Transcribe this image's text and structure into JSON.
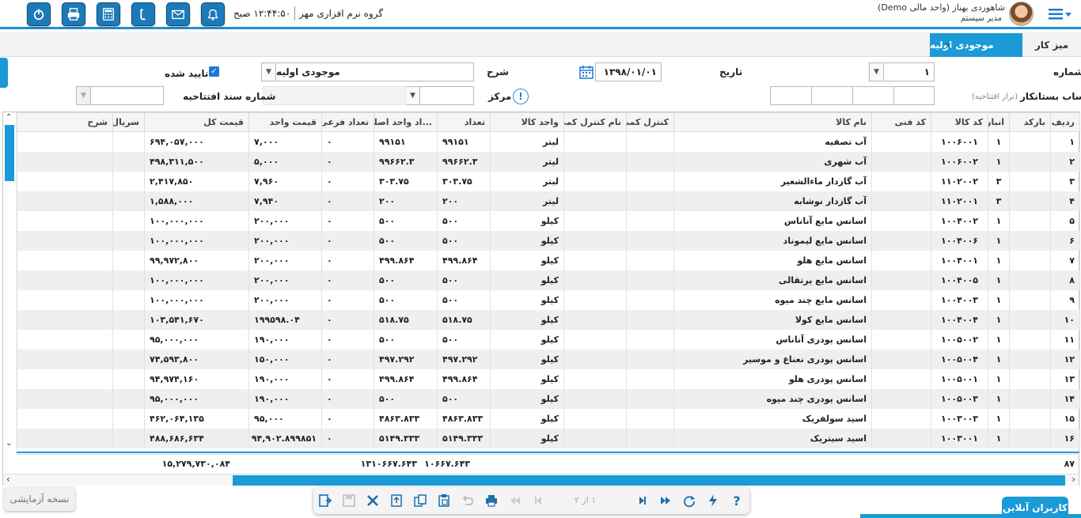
{
  "header": {
    "company": "گروه نرم افزاری مهر",
    "clock": "۱۲:۴۴:۵۰ صبح",
    "user_name": "شاهوردی بهناز (واحد مالی Demo)",
    "user_role": "مدیر سیستم",
    "buttons": [
      "power-icon",
      "printer-icon",
      "calculator-icon",
      "phone-icon",
      "mail-icon",
      "bell-icon"
    ]
  },
  "tabs": {
    "desk": "میز کار",
    "active": "موجودی اولیه",
    "close": "×"
  },
  "form": {
    "number_label": "شماره",
    "number_value": "۱",
    "date_label": "تاریخ",
    "date_value": "۱۳۹۸/۰۱/۰۱",
    "desc_label": "شرح",
    "desc_value": "موجودی اولیه",
    "approved_label": "تایید شده",
    "creditor_label": "حساب بستانکار",
    "creditor_sub": "(تراز افتتاحیه)",
    "center_label": "مرکز",
    "opening_doc_label": "شماره سند افتتاحیه"
  },
  "grid": {
    "columns": [
      "ردیف",
      "بارکد",
      "انبار",
      "کد کالا",
      "کد فنی",
      "نام کالا",
      "کنترل کمی",
      "نام کنترل کمی",
      "واحد کالا",
      "تعداد",
      "...اد واحد اصلی",
      "تعداد فرعی",
      "قیمت واحد",
      "قیمت کل",
      "سریال",
      "شرح"
    ],
    "rows": [
      {
        "n": "۱",
        "store": "۱",
        "code": "۱۰۰۶۰۰۱",
        "name": "آب تصفیه",
        "unit": "لیتر",
        "qty": "۹۹۱۵۱",
        "base": "۹۹۱۵۱",
        "sub": "۰",
        "price": "۷,۰۰۰",
        "total": "۶۹۴,۰۵۷,۰۰۰"
      },
      {
        "n": "۲",
        "store": "۱",
        "code": "۱۰۰۶۰۰۲",
        "name": "آب شهری",
        "unit": "لیتر",
        "qty": "۹۹۶۶۲.۳",
        "base": "۹۹۶۶۲.۳",
        "sub": "۰",
        "price": "۵,۰۰۰",
        "total": "۴۹۸,۳۱۱,۵۰۰"
      },
      {
        "n": "۳",
        "store": "۳",
        "code": "۱۱۰۲۰۰۲",
        "name": "آب گازدار ماءالشعیر",
        "unit": "لیتر",
        "qty": "۳۰۳.۷۵",
        "base": "۳۰۳.۷۵",
        "sub": "۰",
        "price": "۷,۹۶۰",
        "total": "۲,۴۱۷,۸۵۰"
      },
      {
        "n": "۴",
        "store": "۳",
        "code": "۱۱۰۲۰۰۱",
        "name": "آب گازدار نوشابه",
        "unit": "لیتر",
        "qty": "۲۰۰",
        "base": "۲۰۰",
        "sub": "۰",
        "price": "۷,۹۴۰",
        "total": "۱,۵۸۸,۰۰۰"
      },
      {
        "n": "۵",
        "store": "۱",
        "code": "۱۰۰۴۰۰۲",
        "name": "اسانس مایع آناناس",
        "unit": "کیلو",
        "qty": "۵۰۰",
        "base": "۵۰۰",
        "sub": "۰",
        "price": "۲۰۰,۰۰۰",
        "total": "۱۰۰,۰۰۰,۰۰۰"
      },
      {
        "n": "۶",
        "store": "۱",
        "code": "۱۰۰۴۰۰۶",
        "name": "اسانس مایع لیموناد",
        "unit": "کیلو",
        "qty": "۵۰۰",
        "base": "۵۰۰",
        "sub": "۰",
        "price": "۲۰۰,۰۰۰",
        "total": "۱۰۰,۰۰۰,۰۰۰"
      },
      {
        "n": "۷",
        "store": "۱",
        "code": "۱۰۰۴۰۰۱",
        "name": "اسانس مایع هلو",
        "unit": "کیلو",
        "qty": "۴۹۹.۸۶۴",
        "base": "۴۹۹.۸۶۴",
        "sub": "۰",
        "price": "۲۰۰,۰۰۰",
        "total": "۹۹,۹۷۲,۸۰۰"
      },
      {
        "n": "۸",
        "store": "۱",
        "code": "۱۰۰۴۰۰۵",
        "name": "اسانس مایع پرتقالی",
        "unit": "کیلو",
        "qty": "۵۰۰",
        "base": "۵۰۰",
        "sub": "۰",
        "price": "۲۰۰,۰۰۰",
        "total": "۱۰۰,۰۰۰,۰۰۰"
      },
      {
        "n": "۹",
        "store": "۱",
        "code": "۱۰۰۴۰۰۳",
        "name": "اسانس مایع چند میوه",
        "unit": "کیلو",
        "qty": "۵۰۰",
        "base": "۵۰۰",
        "sub": "۰",
        "price": "۲۰۰,۰۰۰",
        "total": "۱۰۰,۰۰۰,۰۰۰"
      },
      {
        "n": "۱۰",
        "store": "۱",
        "code": "۱۰۰۴۰۰۴",
        "name": "اسانس مایع کولا",
        "unit": "کیلو",
        "qty": "۵۱۸.۷۵",
        "base": "۵۱۸.۷۵",
        "sub": "۰",
        "price": "۱۹۹۵۹۸.۰۴",
        "total": "۱۰۳,۵۴۱,۶۷۰"
      },
      {
        "n": "۱۱",
        "store": "۱",
        "code": "۱۰۰۵۰۰۲",
        "name": "اسانس پودری آناناس",
        "unit": "کیلو",
        "qty": "۵۰۰",
        "base": "۵۰۰",
        "sub": "۰",
        "price": "۱۹۰,۰۰۰",
        "total": "۹۵,۰۰۰,۰۰۰"
      },
      {
        "n": "۱۲",
        "store": "۱",
        "code": "۱۰۰۵۰۰۴",
        "name": "اسانس پودری نعناع و موسیر",
        "unit": "کیلو",
        "qty": "۴۹۷.۲۹۲",
        "base": "۴۹۷.۲۹۲",
        "sub": "۰",
        "price": "۱۵۰,۰۰۰",
        "total": "۷۴,۵۹۳,۸۰۰"
      },
      {
        "n": "۱۳",
        "store": "۱",
        "code": "۱۰۰۵۰۰۱",
        "name": "اسانس پودری هلو",
        "unit": "کیلو",
        "qty": "۴۹۹.۸۶۴",
        "base": "۴۹۹.۸۶۴",
        "sub": "۰",
        "price": "۱۹۰,۰۰۰",
        "total": "۹۴,۹۷۴,۱۶۰"
      },
      {
        "n": "۱۴",
        "store": "۱",
        "code": "۱۰۰۵۰۰۳",
        "name": "اسانس پودری چند میوه",
        "unit": "کیلو",
        "qty": "۵۰۰",
        "base": "۵۰۰",
        "sub": "۰",
        "price": "۱۹۰,۰۰۰",
        "total": "۹۵,۰۰۰,۰۰۰"
      },
      {
        "n": "۱۵",
        "store": "۱",
        "code": "۱۰۰۳۰۰۳",
        "name": "اسید سولفریک",
        "unit": "کیلو",
        "qty": "۴۸۶۳.۸۳۳",
        "base": "۴۸۶۳.۸۳۳",
        "sub": "۰",
        "price": "۹۵,۰۰۰",
        "total": "۴۶۲,۰۶۴,۱۳۵"
      },
      {
        "n": "۱۶",
        "store": "۱",
        "code": "۱۰۰۳۰۰۱",
        "name": "اسید سیتریک",
        "unit": "کیلو",
        "qty": "۵۱۴۹.۳۳۳",
        "base": "۵۱۴۹.۳۳۳",
        "sub": "۰",
        "price": "۹۴,۹۰۲.۸۹۹۸۵۱",
        "total": "۴۸۸,۶۸۶,۶۳۴"
      }
    ],
    "footer": {
      "count": "۸۷",
      "qty_total": "۱۰۶۶۷.۶۴۳",
      "base_total": "۱۳۱۰۶۶۷.۶۴۳",
      "grand_total": "۱۵,۲۷۹,۷۳۰,۰۸۴"
    }
  },
  "toolbar": {
    "page_info": "۱ از ۲"
  },
  "trial_label": "نسخه آزمایشی",
  "online_users": "کاربران آنلاین",
  "colors": {
    "accent": "#1a9ad6",
    "header_btn": "#1c7ab8"
  }
}
